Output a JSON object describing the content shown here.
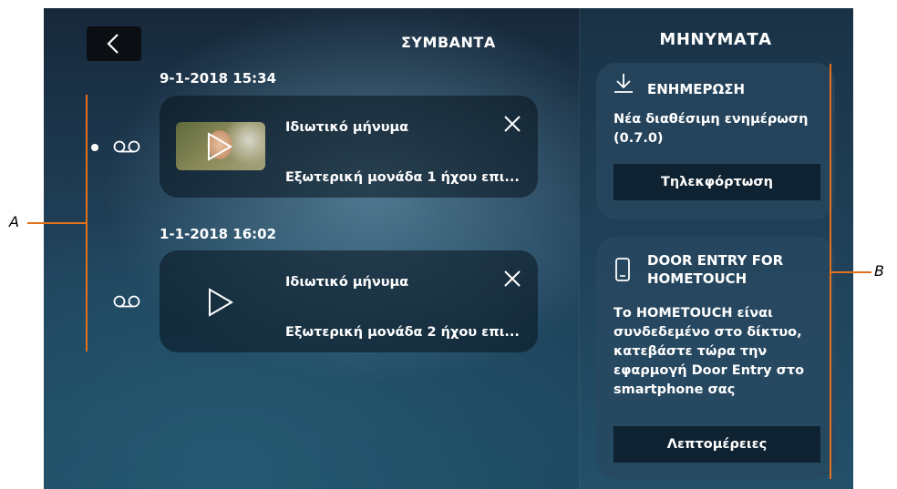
{
  "header": {
    "back_icon": "chevron-left-icon",
    "events_title": "ΣΥΜΒΑΝΤΑ",
    "messages_title": "ΜΗΝΥΜΑΤΑ"
  },
  "events": [
    {
      "date": "9-1-2018  15:34",
      "title": "Ιδιωτικό μήνυμα",
      "subtitle": "Εξωτερική μονάδα 1 ήχου επι...",
      "unread": true,
      "has_thumbnail": true
    },
    {
      "date": "1-1-2018  16:02",
      "title": "Ιδιωτικό μήνυμα",
      "subtitle": "Εξωτερική μονάδα 2 ήχου επι...",
      "unread": false,
      "has_thumbnail": false
    }
  ],
  "messages": [
    {
      "icon": "download-icon",
      "title": "ΕΝΗΜΕΡΩΣΗ",
      "body": "Νέα διαθέσιμη ενημέρωση (0.7.0)",
      "button": "Τηλεκφόρτωση"
    },
    {
      "icon": "smartphone-icon",
      "title": "DOOR ENTRY FOR HOMETOUCH",
      "body": "Το HOMETOUCH είναι συνδεδεμένο στο δίκτυο, κατεβάστε τώρα την εφαρμογή Door Entry στο smartphone σας",
      "button": "Λεπτομέρειες"
    }
  ],
  "annotations": {
    "left_label": "A",
    "right_label": "B",
    "line_color": "#e2711d"
  }
}
